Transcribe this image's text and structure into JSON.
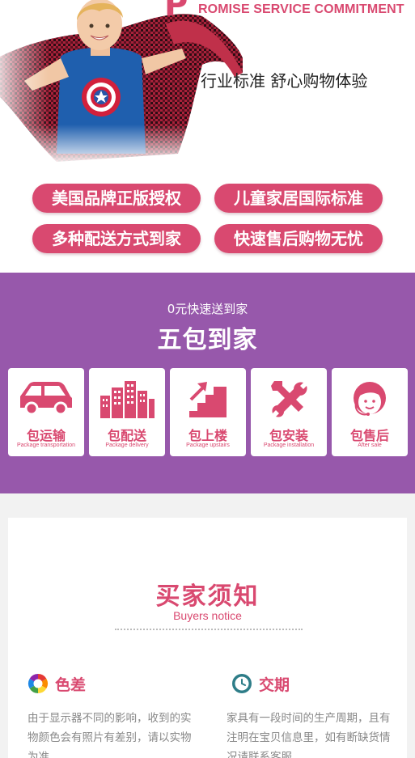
{
  "hero": {
    "letter": "P",
    "heading": "ROMISE SERVICE COMMITMENT",
    "subtitle": "行业标准 舒心购物体验"
  },
  "promises": [
    {
      "label": "美国品牌正版授权"
    },
    {
      "label": "儿童家居国际标准"
    },
    {
      "label": "多种配送方式到家"
    },
    {
      "label": "快速售后购物无忧"
    }
  ],
  "delivery": {
    "small_title": "0元快速送到家",
    "big_title": "五包到家",
    "items": [
      {
        "icon": "car-icon",
        "cn": "包运输",
        "en": "Package transportation"
      },
      {
        "icon": "buildings-icon",
        "cn": "包配送",
        "en": "Package delivery"
      },
      {
        "icon": "stairs-icon",
        "cn": "包上楼",
        "en": "Package upstairs"
      },
      {
        "icon": "tools-icon",
        "cn": "包安装",
        "en": "Package installation"
      },
      {
        "icon": "headset-agent-icon",
        "cn": "包售后",
        "en": "After sale"
      }
    ]
  },
  "notice": {
    "title": "买家须知",
    "subtitle": "Buyers notice",
    "items": [
      {
        "icon": "color-wheel-icon",
        "title": "色差",
        "text": "由于显示器不同的影响，收到的实物颜色会有照片有差别，请以实物为准"
      },
      {
        "icon": "clock-icon",
        "title": "交期",
        "text": "家具有一段时间的生产周期，且有注明在宝贝信息里，如有断缺货情况请联系客服"
      }
    ]
  },
  "colors": {
    "accent": "#d94970",
    "purple": "#9758ab",
    "background_gray": "#f2f2f2"
  }
}
